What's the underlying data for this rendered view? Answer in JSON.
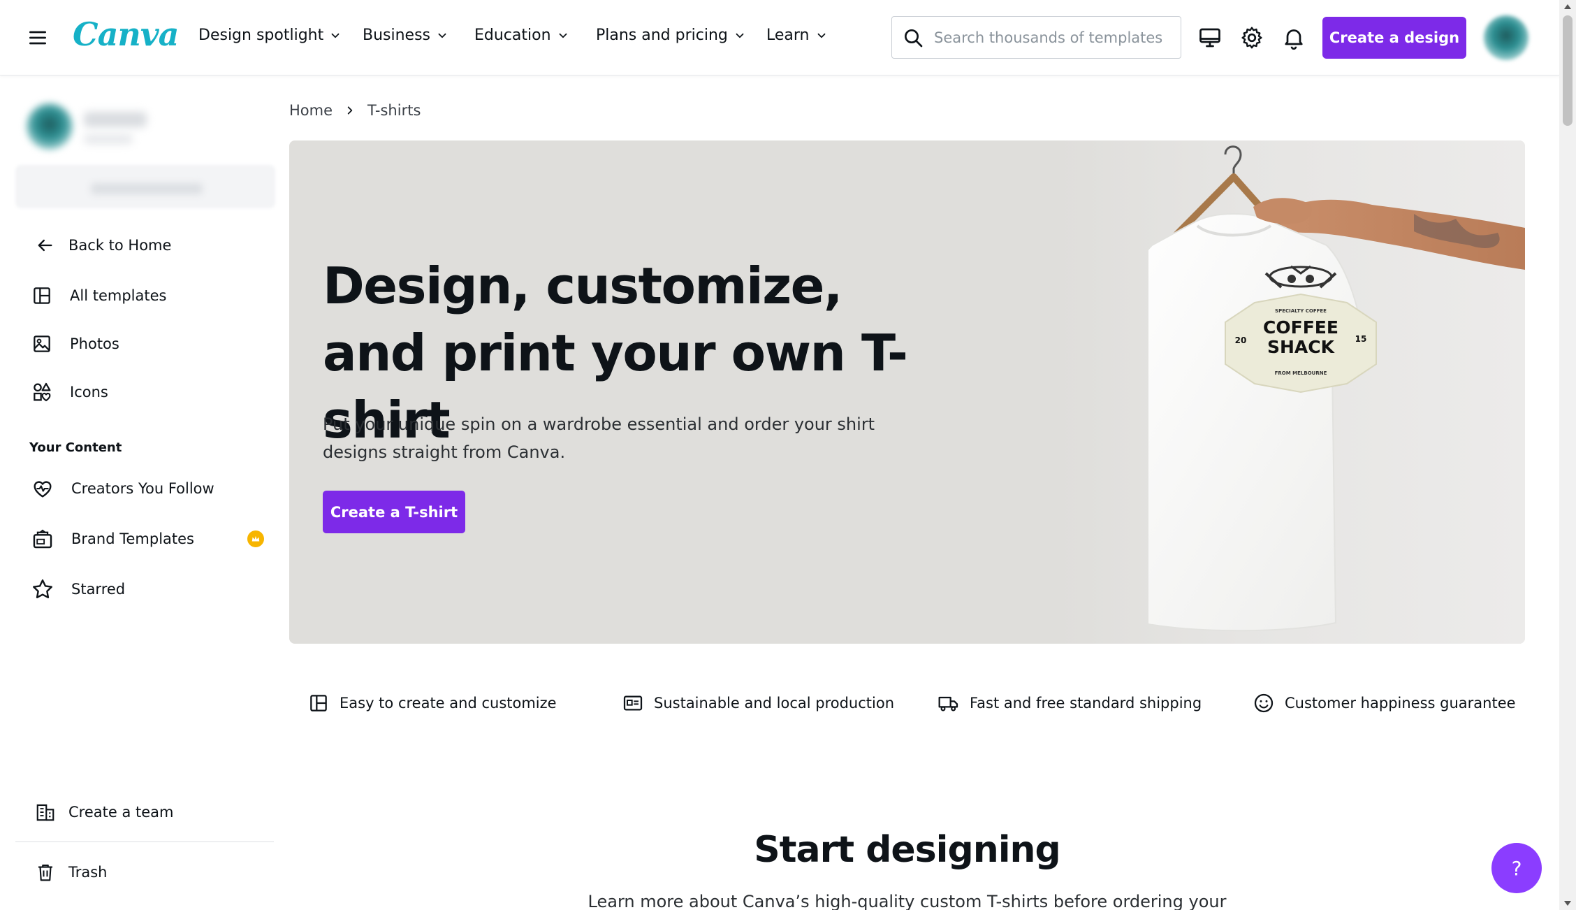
{
  "header": {
    "logo": "Canva",
    "nav": [
      {
        "label": "Design spotlight"
      },
      {
        "label": "Business"
      },
      {
        "label": "Education"
      },
      {
        "label": "Plans and pricing"
      },
      {
        "label": "Learn"
      }
    ],
    "search_placeholder": "Search thousands of templates",
    "create_button": "Create a design",
    "icons": [
      "desktop-icon",
      "gear-icon",
      "bell-icon"
    ]
  },
  "sidebar": {
    "back": "Back to Home",
    "items": [
      {
        "label": "All templates",
        "icon": "templates-icon"
      },
      {
        "label": "Photos",
        "icon": "photo-icon"
      },
      {
        "label": "Icons",
        "icon": "shapes-icon"
      }
    ],
    "section_title": "Your Content",
    "content_items": [
      {
        "label": "Creators You Follow",
        "icon": "heart-icon"
      },
      {
        "label": "Brand Templates",
        "icon": "brand-icon"
      },
      {
        "label": "Starred",
        "icon": "star-icon"
      }
    ],
    "create_team": "Create a team",
    "trash": "Trash"
  },
  "breadcrumb": [
    "Home",
    "T-shirts"
  ],
  "hero": {
    "title": "Design, customize, and print your own T-shirt",
    "subtitle": "Put your unique spin on a wardrobe essential and order your shirt designs straight from Canva.",
    "button": "Create a T-shirt",
    "shirt_logo": {
      "line1": "COFFEE",
      "line2": "SHACK",
      "left": "20",
      "right": "15",
      "top": "SPECIALTY COFFEE",
      "bottom": "FROM MELBOURNE"
    }
  },
  "features": [
    {
      "label": "Easy to create and customize",
      "icon": "layout-icon"
    },
    {
      "label": "Sustainable and local production",
      "icon": "id-card-icon"
    },
    {
      "label": "Fast and free standard shipping",
      "icon": "truck-icon"
    },
    {
      "label": "Customer happiness guarantee",
      "icon": "smile-icon"
    }
  ],
  "section": {
    "title": "Start designing",
    "subtitle": "Learn more about Canva’s high-quality custom T-shirts before ordering your"
  },
  "help": "?",
  "colors": {
    "accent": "#7d2ae8",
    "logo": "#16b1c7",
    "hero_bg": "#dfdedb",
    "crown": "#f7b500"
  }
}
